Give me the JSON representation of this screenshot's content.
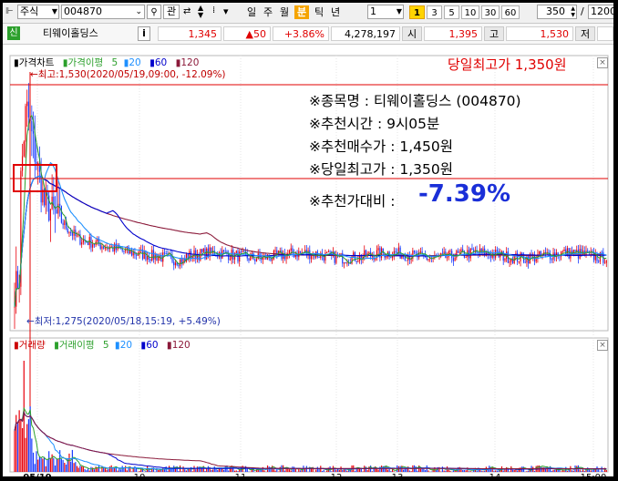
{
  "toolbar": {
    "market": "주식",
    "code": "004870",
    "search_icon": "search-icon",
    "kwan": "관",
    "periods": [
      "일",
      "주",
      "월",
      "분",
      "틱",
      "년"
    ],
    "selected_period": "분",
    "interval_value": "1",
    "interval_buttons": [
      "1",
      "3",
      "5",
      "10",
      "30",
      "60"
    ],
    "selected_interval": "1",
    "count_value": "350",
    "slash": "/",
    "total_value": "1200"
  },
  "infobar": {
    "badge": "신",
    "stock_name": "티웨이홀딩스",
    "info_button": "i",
    "price": "1,345",
    "change": "▲50",
    "change_pct": "+3.86%",
    "volume": "4,278,197",
    "open_label": "시",
    "open_value": "1,395",
    "high_label": "고",
    "high_value": "1,530",
    "low_label": "저"
  },
  "price_panel": {
    "legend": [
      "가격차트",
      "가격이평",
      "5",
      "20",
      "60",
      "120"
    ],
    "legend_colors": [
      "#000000",
      "#2ca02c",
      "#2ca02c",
      "#1e90ff",
      "#0000cc",
      "#8b1a3a"
    ],
    "high_annotation": "←최고:1,530(2020/05/19,09:00, -12.09%)",
    "low_annotation": "←최저:1,275(2020/05/18,15:19, +5.49%)",
    "red_title": "당일최고가 1,350원",
    "notes": [
      "※종목명 : 티웨이홀딩스 (004870)",
      "※추천시간 : 9시05분",
      "※추천매수가 : 1,450원",
      "※당일최고가 : 1,350원"
    ],
    "compare_label": "※추천가대비 : ",
    "compare_value": "-7.39%"
  },
  "volume_panel": {
    "legend": [
      "거래량",
      "거래이평",
      "5",
      "20",
      "60",
      "120"
    ],
    "legend_colors": [
      "#cc0000",
      "#2ca02c",
      "#2ca02c",
      "#1e90ff",
      "#0000cc",
      "#8b1a3a"
    ]
  },
  "x_axis": {
    "labels": [
      "05/19",
      "10",
      "11",
      "12",
      "13",
      "14",
      "15:00"
    ]
  },
  "colors": {
    "up": "#e8000b",
    "down": "#1a3cff",
    "ma5": "#2ca02c",
    "ma20": "#1e90ff",
    "ma60": "#0000cc",
    "ma120": "#8b1a3a",
    "accent": "#f5a400",
    "title_red": "#e00000",
    "highlight_blue": "#1a2fd8"
  }
}
